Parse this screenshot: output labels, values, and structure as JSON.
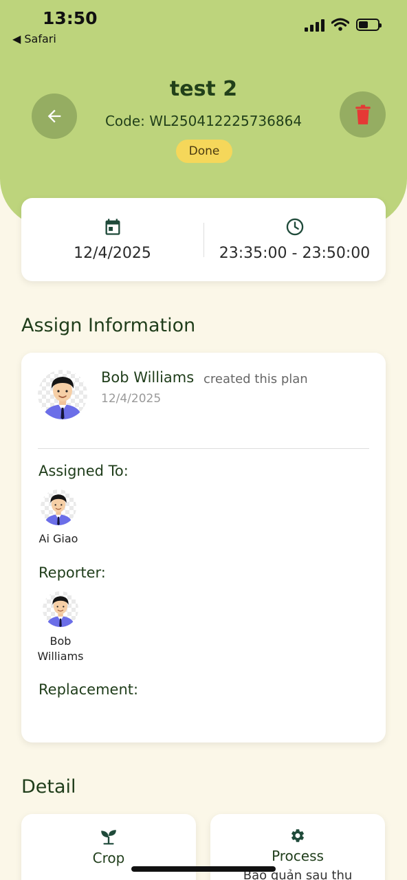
{
  "status_bar": {
    "time": "13:50",
    "back_app": "◀ Safari"
  },
  "header": {
    "title": "test 2",
    "code": "Code: WL250412225736864",
    "status": "Done",
    "back_icon": "arrow-left-icon",
    "delete_icon": "trash-icon"
  },
  "schedule": {
    "date": "12/4/2025",
    "time_range": "23:35:00 - 23:50:00",
    "date_icon": "calendar-icon",
    "time_icon": "clock-icon"
  },
  "assign_info": {
    "heading": "Assign Information",
    "creator_name": "Bob Williams",
    "creator_action": "created this plan",
    "created_date": "12/4/2025",
    "assigned_to_label": "Assigned To:",
    "assigned_to": [
      {
        "name": "Ai Giao"
      }
    ],
    "reporter_label": "Reporter:",
    "reporters": [
      {
        "name": "Bob Williams"
      }
    ],
    "replacement_label": "Replacement:"
  },
  "detail": {
    "heading": "Detail",
    "items": [
      {
        "label": "Crop",
        "icon": "sprout-icon",
        "sub": ""
      },
      {
        "label": "Process",
        "icon": "gear-icon",
        "sub": "Bảo quản sau thu"
      }
    ]
  },
  "colors": {
    "header_green": "#bdd47c",
    "button_green": "#95ad62",
    "badge_yellow": "#f5d75a",
    "delete_red": "#e53935",
    "text_dark_green": "#1f3d1a",
    "background": "#fbf7e8"
  }
}
